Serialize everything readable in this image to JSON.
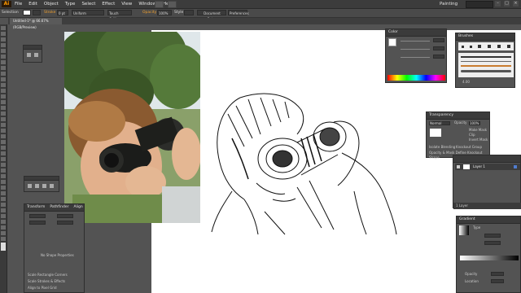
{
  "menubar": {
    "logo": "Ai",
    "items": [
      "File",
      "Edit",
      "Object",
      "Type",
      "Select",
      "Effect",
      "View",
      "Window",
      "Help"
    ],
    "workspace": "Painting",
    "window_buttons": [
      "–",
      "□",
      "×"
    ]
  },
  "control_bar": {
    "selection": "Selection",
    "stroke_label": "Stroke",
    "stroke_value": "0 pt",
    "profile": "Uniform",
    "brush": "Touch Callig...",
    "opacity_label": "Opacity",
    "opacity_value": "100%",
    "style_label": "Style",
    "document_setup": "Document Setup",
    "preferences": "Preferences"
  },
  "document_tab": "Untitled-1* @ 66.67% (RGB/Preview)",
  "panels": {
    "color": {
      "title": "Color"
    },
    "brushes": {
      "title": "Brushes",
      "size_value": "4.00"
    },
    "transparency": {
      "title": "Transparency",
      "blend_mode": "Normal",
      "opacity_label": "Opacity",
      "opacity_value": "100%",
      "make_mask": "Make Mask",
      "clip": "Clip",
      "invert_mask": "Invert Mask",
      "isolate_blending": "Isolate Blending",
      "knockout_group": "Knockout Group",
      "opacity_mask_note": "Opacity & Mask Define Knockout Shape"
    },
    "layers": {
      "layer_name": "Layer 1",
      "footer": "1 Layer"
    },
    "transform": {
      "tabs": [
        "Transform",
        "Pathfinder",
        "Align"
      ],
      "message": "No Shape Properties",
      "scale_rect_corners": "Scale Rectangle Corners",
      "scale_strokes": "Scale Strokes & Effects",
      "align_pixel_grid": "Align to Pixel Grid"
    },
    "gradient": {
      "title": "Gradient",
      "type_label": "Type",
      "opacity_label": "Opacity",
      "location_label": "Location"
    }
  },
  "colors": {
    "app_bg": "#535353",
    "panel_header": "#3b3b3b",
    "accent": "#f0a030",
    "artboard": "#ffffff"
  },
  "icons": [
    "ai-logo-icon",
    "search-icon",
    "minimize-icon",
    "maximize-icon",
    "close-icon",
    "tool-icon",
    "swatch-icon",
    "brush-icon",
    "eye-icon",
    "layer-thumbnail-icon"
  ]
}
